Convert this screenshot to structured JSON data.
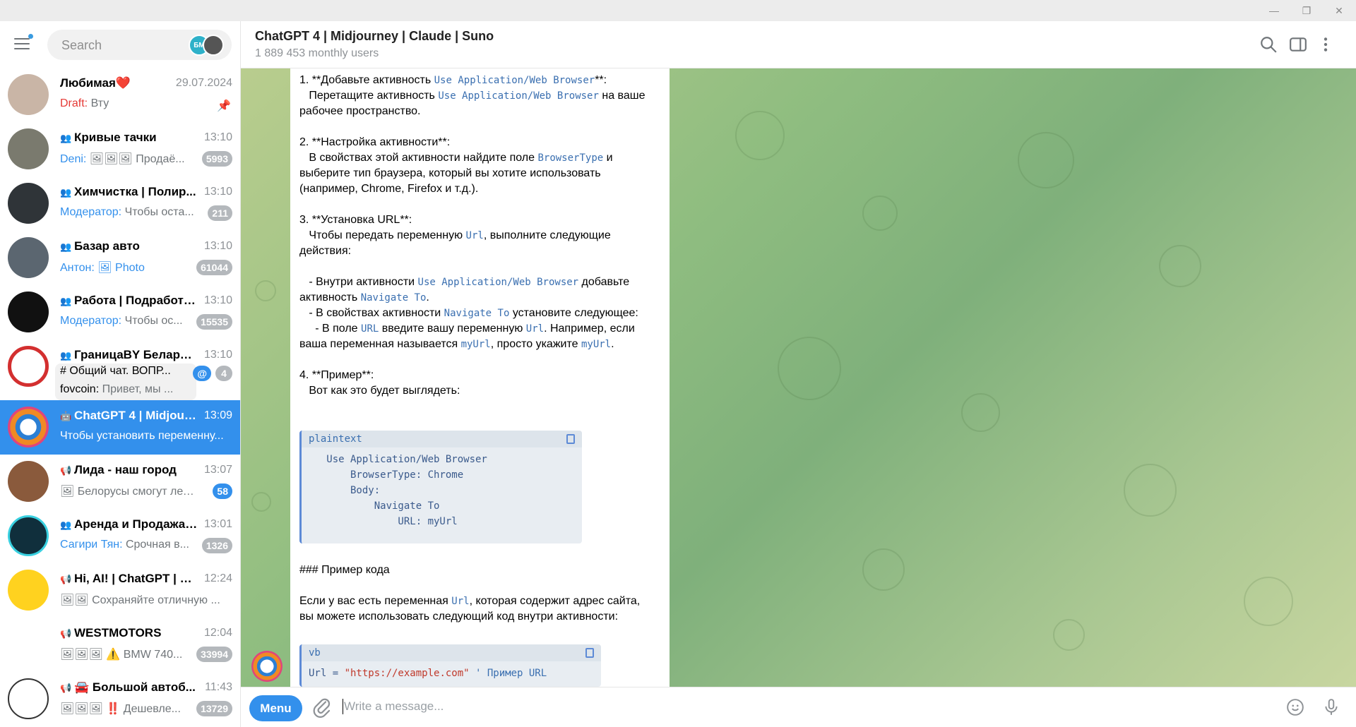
{
  "header": {
    "title": "ChatGPT 4 | Midjourney | Claude | Suno",
    "subtitle": "1 889 453 monthly users"
  },
  "sidebar": {
    "search_placeholder": "Search",
    "search_chip": "БМ",
    "chats": [
      {
        "title": "Любимая❤️",
        "time": "29.07.2024",
        "draft_label": "Draft:",
        "preview": " Вту",
        "pinned": true,
        "type": "user"
      },
      {
        "title": "Кривые тачки",
        "time": "13:10",
        "sender": "Deni:",
        "preview": " 🖼🖼🖼 Продаё...",
        "badge": "5993",
        "type": "group"
      },
      {
        "title": "Химчистка | Полир...",
        "time": "13:10",
        "sender": "Модератор:",
        "preview": " Чтобы оста...",
        "badge": "211",
        "type": "group"
      },
      {
        "title": "Базар авто",
        "time": "13:10",
        "sender": "Антон:",
        "preview": " 🖼 Photo",
        "badge": "61044",
        "type": "group"
      },
      {
        "title": "Работа | Подработк...",
        "time": "13:10",
        "sender": "Модератор:",
        "preview": " Чтобы ос...",
        "badge": "15535",
        "type": "group"
      },
      {
        "title": "ГраницаBY Беларус...",
        "time": "13:10",
        "topic": "# Общий чат. ВОПР...",
        "sender": "fovcoin:",
        "preview": " Привет, мы ...",
        "badge": "4",
        "mention": "@",
        "type": "forum"
      },
      {
        "title": "ChatGPT 4 | Midjour...",
        "time": "13:09",
        "preview": "Чтобы установить переменну...",
        "type": "bot",
        "active": true
      },
      {
        "title": "Лида - наш город",
        "time": "13:07",
        "preview": "🖼 Белорусы смогут лета...",
        "badge": "58",
        "badge_blue": true,
        "type": "channel"
      },
      {
        "title": "Аренда и Продажа ...",
        "time": "13:01",
        "sender": "Сагири Тян:",
        "preview": " Срочная в...",
        "badge": "1326",
        "type": "group"
      },
      {
        "title": "Hi, AI! | ChatGPT | не...",
        "time": "12:24",
        "preview": "🖼🖼 Сохраняйте отличную ...",
        "type": "channel"
      },
      {
        "title": "WESTMOTORS",
        "time": "12:04",
        "preview": "🖼🖼🖼 ⚠️ BMW 740...",
        "badge": "33994",
        "type": "channel"
      },
      {
        "title": "🚘 Большой автоб...",
        "time": "11:43",
        "preview": "🖼🖼🖼 ‼️ Дешевле...",
        "badge": "13729",
        "type": "channel"
      }
    ]
  },
  "message": {
    "p1_a": "1. **Добавьте активность ",
    "p1_code": "Use Application/Web Browser",
    "p1_b": "**:",
    "p1_c": "   Перетащите активность ",
    "p1_code2": "Use Application/Web Browser",
    "p1_d": " на ваше рабочее пространство.",
    "p2_a": "2. **Настройка активности**:",
    "p2_b": "   В свойствах этой активности найдите поле ",
    "p2_code": "BrowserType",
    "p2_c": " и выберите тип браузера, который вы хотите использовать (например, Chrome, Firefox и т.д.).",
    "p3_a": "3. **Установка URL**:",
    "p3_b": "   Чтобы передать переменную ",
    "p3_code": "Url",
    "p3_c": ", выполните следующие действия:",
    "p4_a": "   - Внутри активности ",
    "p4_code": "Use Application/Web Browser",
    "p4_b": " добавьте активность ",
    "p4_code2": "Navigate To",
    "p4_c": ".",
    "p4_d": "   - В свойствах активности ",
    "p4_code3": "Navigate To",
    "p4_e": " установите следующее:",
    "p4_f": "     - В поле ",
    "p4_code4": "URL",
    "p4_g": " введите вашу переменную ",
    "p4_code5": "Url",
    "p4_h": ". Например, если ваша переменная называется ",
    "p4_code6": "myUrl",
    "p4_i": ", просто укажите ",
    "p4_code7": "myUrl",
    "p4_j": ".",
    "p5_a": "4. **Пример**:",
    "p5_b": "   Вот как это будет выглядеть:",
    "code1_lang": "plaintext",
    "code1_body": "   Use Application/Web Browser\n       BrowserType: Chrome\n       Body:\n           Navigate To\n               URL: myUrl",
    "heading": "### Пример кода",
    "p6_a": "Если у вас есть переменная ",
    "p6_code": "Url",
    "p6_b": ", которая содержит адрес сайта, вы можете использовать следующий код внутри активности:",
    "code2_lang": "vb",
    "code2_var": "Url = ",
    "code2_str": "\"https://example.com\"",
    "code2_cmt": " ' Пример URL"
  },
  "input": {
    "menu_label": "Menu",
    "placeholder": "Write a message..."
  },
  "colors": {
    "accent": "#3390ec",
    "badge_muted": "#b4b8bc",
    "code": "#3a6fb0"
  }
}
